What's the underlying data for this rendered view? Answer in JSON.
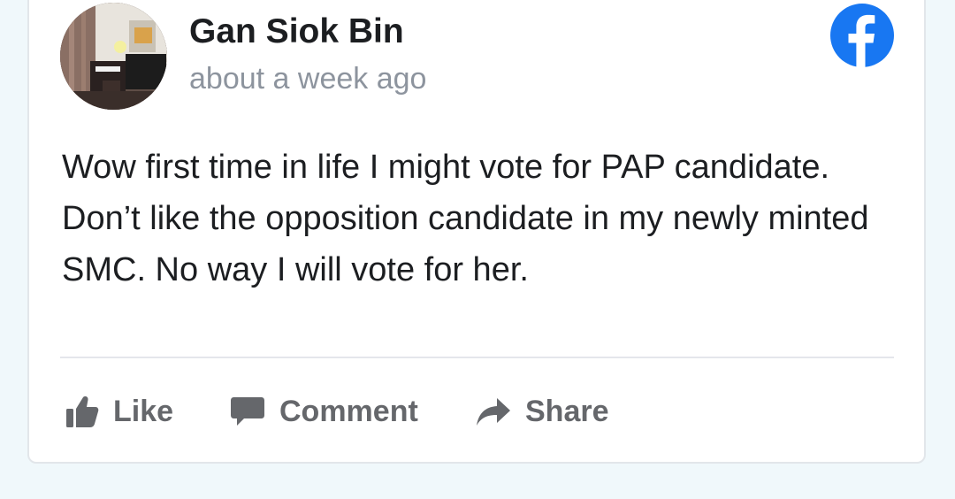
{
  "post": {
    "author": "Gan Siok Bin",
    "timestamp": "about a week ago",
    "text": "Wow first time in life I might vote for PAP candidate. Don’t like the opposition candidate in my newly minted SMC. No way I will vote for her.",
    "platform_icon": "facebook-icon",
    "brand_color": "#1877f2"
  },
  "actions": {
    "like_label": "Like",
    "comment_label": "Comment",
    "share_label": "Share",
    "icons": [
      "thumbs-up-icon",
      "comment-icon",
      "share-icon"
    ],
    "color": "#65676b"
  }
}
